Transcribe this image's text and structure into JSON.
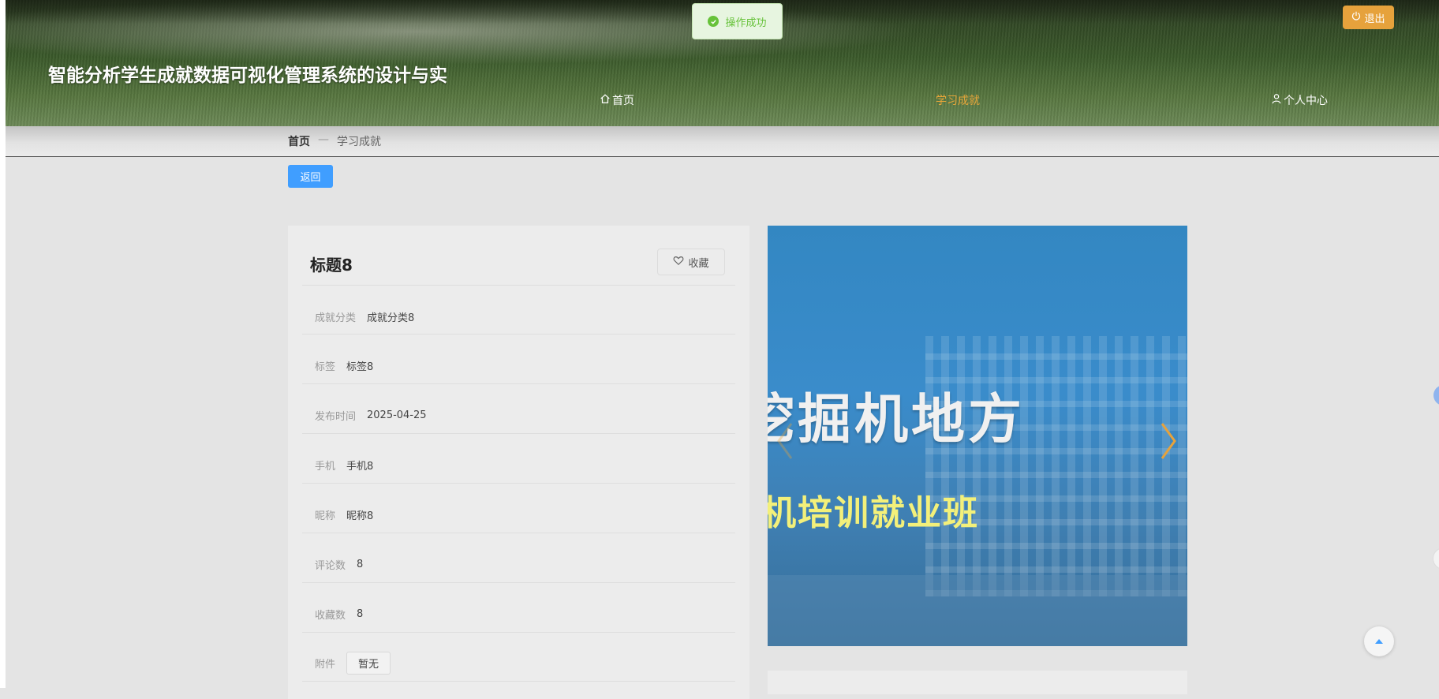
{
  "header": {
    "site_title": "智能分析学生成就数据可视化管理系统的设计与实现",
    "nav": [
      {
        "label": "首页",
        "icon": "home-icon",
        "active": false
      },
      {
        "label": "学习成就",
        "icon": "",
        "active": true
      },
      {
        "label": "个人中心",
        "icon": "user-icon",
        "active": false
      }
    ],
    "logout_label": "退出",
    "accent_color": "#e6a23c"
  },
  "toast": {
    "message": "操作成功",
    "icon": "check-circle-icon",
    "color": "#67c23a"
  },
  "breadcrumb": {
    "home": "首页",
    "separator": "—",
    "current": "学习成就"
  },
  "back_button": {
    "label": "返回",
    "color": "#409eff"
  },
  "detail": {
    "title": "标题8",
    "favorite_label": "收藏",
    "fields": [
      {
        "label": "成就分类",
        "value": "成就分类8"
      },
      {
        "label": "标签",
        "value": "标签8"
      },
      {
        "label": "发布时间",
        "value": "2025-04-25"
      },
      {
        "label": "手机",
        "value": "手机8"
      },
      {
        "label": "昵称",
        "value": "昵称8"
      },
      {
        "label": "评论数",
        "value": "8"
      },
      {
        "label": "收藏数",
        "value": "8"
      }
    ],
    "attachment": {
      "label": "附件",
      "value": "暂无"
    }
  },
  "carousel": {
    "image_text_line1": "挖掘机地方",
    "image_text_line2": "机培训就业班",
    "arrow_color": "#e6a23c"
  }
}
